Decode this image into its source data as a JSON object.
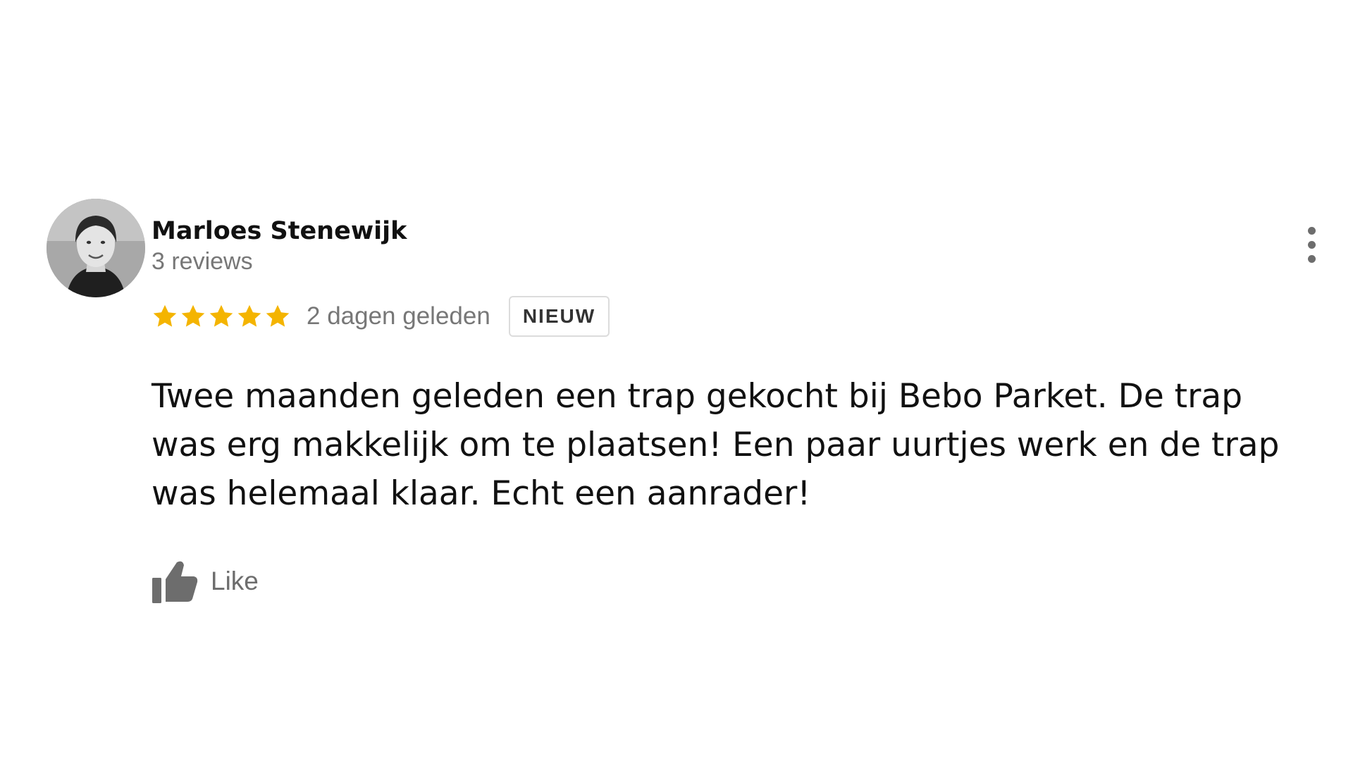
{
  "review": {
    "author": "Marloes Stenewijk",
    "review_count": "3 reviews",
    "rating": 5,
    "rating_max": 5,
    "time": "2 dagen geleden",
    "badge": "NIEUW",
    "text": "Twee maanden geleden een trap gekocht bij Bebo Parket. De trap was erg makkelijk om te plaatsen! Een paar uurtjes werk en de trap was helemaal klaar. Echt een aanrader!",
    "like_label": "Like"
  },
  "icons": {
    "star": "star-icon",
    "like": "thumbs-up-icon",
    "menu": "more-vert-icon"
  },
  "colors": {
    "star": "#f4b400",
    "muted_text": "#777777",
    "icon_gray": "#6d6d6d",
    "text": "#111111"
  }
}
